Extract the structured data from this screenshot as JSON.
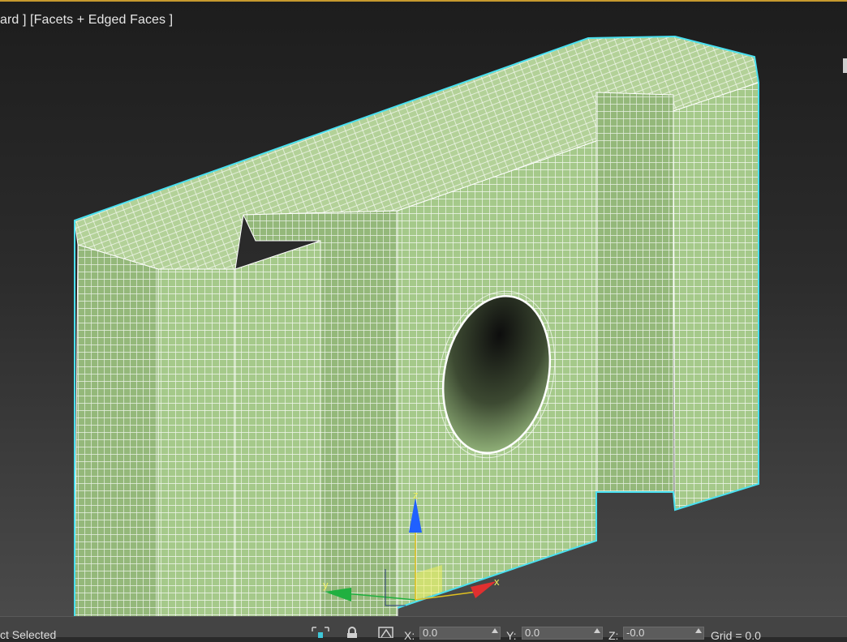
{
  "viewport": {
    "label": "ard ] [Facets + Edged Faces ]"
  },
  "gizmo": {
    "x_label": "x",
    "y_label": "y",
    "z_label": "z"
  },
  "statusbar": {
    "status_text": "ct Selected",
    "x_label": "X:",
    "x_value": "0.0",
    "y_label": "Y:",
    "y_value": "0.0",
    "z_label": "Z:",
    "z_value": "-0.0",
    "grid_text": "Grid = 0.0"
  },
  "colors": {
    "accent_border": "#c79a2e",
    "mesh_fill": "#a9cc8a",
    "selection_outline": "#49e0f0",
    "axis_x": "#e03030",
    "axis_y": "#20b040",
    "axis_z": "#2060ff"
  }
}
